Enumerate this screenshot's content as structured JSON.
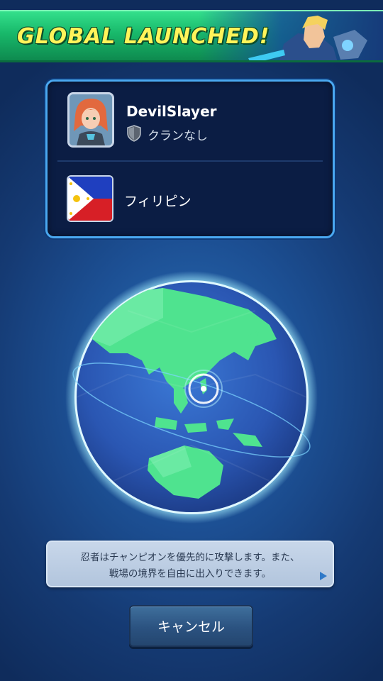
{
  "banner": {
    "title": "GLOBAL LAUNCHED!"
  },
  "profile": {
    "name": "DevilSlayer",
    "clan": "クランなし",
    "country": "フィリピン"
  },
  "tip": {
    "line1": "忍者はチャンピオンを優先的に攻撃します。また、",
    "line2": "戦場の境界を自由に出入りできます。"
  },
  "cancel_button": {
    "label": "キャンセル"
  },
  "colors": {
    "banner_green": "#18b86a",
    "banner_text": "#fff45a",
    "card_border": "#4aa8f0",
    "card_bg": "#0b1d44",
    "globe_land": "#4fe38f",
    "globe_ocean": "#2e63c4"
  },
  "icons": [
    "shield-icon",
    "philippines-flag-icon",
    "next-arrow-icon",
    "globe-illustration",
    "location-marker-icon"
  ]
}
